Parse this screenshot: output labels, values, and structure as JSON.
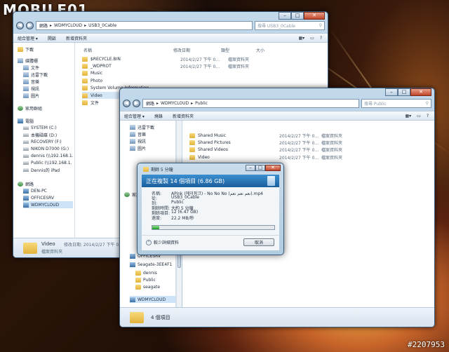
{
  "watermark": {
    "logo": "MOBILE01",
    "id": "#2207953"
  },
  "back_window": {
    "breadcrumb": [
      "網路",
      "WDMYCLOUD",
      "USB3_0Cable"
    ],
    "search_placeholder": "搜尋 USB3_0Cable",
    "toolbar": [
      "組合管理 ▾",
      "開啟",
      "新增資料夾"
    ],
    "nav_items": [
      {
        "label": "下載",
        "icon": "folder-icon"
      },
      {
        "label": "媒體櫃",
        "icon": "library-icon"
      },
      {
        "label": "文件",
        "icon": "library-icon"
      },
      {
        "label": "迅雷下載",
        "icon": "library-icon"
      },
      {
        "label": "音樂",
        "icon": "library-icon"
      },
      {
        "label": "視訊",
        "icon": "library-icon"
      },
      {
        "label": "圖片",
        "icon": "library-icon"
      },
      {
        "label": "家用群組",
        "icon": "homegroup-icon"
      },
      {
        "label": "電腦",
        "icon": "computer-icon"
      },
      {
        "label": "SYSTEM (C:)",
        "icon": "drive-icon"
      },
      {
        "label": "本機磁碟 (D:)",
        "icon": "drive-icon"
      },
      {
        "label": "RECOVERY (F:)",
        "icon": "drive-icon"
      },
      {
        "label": "NIKON D7000 (G:)",
        "icon": "drive-icon"
      },
      {
        "label": "dennis (\\\\192.168.1.",
        "icon": "drive-icon"
      },
      {
        "label": "Public (\\\\192.168.1.",
        "icon": "drive-icon"
      },
      {
        "label": "Dennis的 iPad",
        "icon": "drive-icon"
      },
      {
        "label": "網路",
        "icon": "network-icon"
      },
      {
        "label": "DEN-PC",
        "icon": "computer-icon"
      },
      {
        "label": "OFFICESRV",
        "icon": "computer-icon"
      },
      {
        "label": "WDMYCLOUD",
        "icon": "computer-icon"
      }
    ],
    "columns": [
      "名稱",
      "修改日期",
      "類型",
      "大小"
    ],
    "files": [
      {
        "name": "$RECYCLE.BIN",
        "date": "2014/2/27 下午 0...",
        "type": "檔案資料夾"
      },
      {
        "name": "_WDPROT",
        "date": "2014/2/27 下午 0...",
        "type": "檔案資料夾"
      },
      {
        "name": "Music",
        "date": "",
        "type": ""
      },
      {
        "name": "Photo",
        "date": "",
        "type": ""
      },
      {
        "name": "System Volume Information",
        "date": "",
        "type": ""
      },
      {
        "name": "Video",
        "date": "",
        "type": ""
      },
      {
        "name": "文件",
        "date": "",
        "type": ""
      }
    ],
    "status": {
      "name": "Video",
      "detail": "修改日期: 2014/2/27 下午 05...",
      "type": "檔案資料夾"
    }
  },
  "front_window": {
    "breadcrumb": [
      "網路",
      "WDMYCLOUD",
      "Public"
    ],
    "search_placeholder": "搜尋 Public",
    "toolbar": [
      "組合管理 ▾",
      "燒錄",
      "新增資料夾"
    ],
    "nav_items": [
      {
        "label": "迅雷下載",
        "icon": "library-icon"
      },
      {
        "label": "音樂",
        "icon": "library-icon"
      },
      {
        "label": "視訊",
        "icon": "library-icon"
      },
      {
        "label": "圖片",
        "icon": "library-icon"
      },
      {
        "label": "家用群組",
        "icon": "homegroup-icon"
      },
      {
        "label": "OFFICESRV",
        "icon": "computer-icon"
      },
      {
        "label": "Seagate-3EE4F1",
        "icon": "computer-icon"
      },
      {
        "label": "dennis",
        "icon": "folder-icon"
      },
      {
        "label": "Public",
        "icon": "folder-icon"
      },
      {
        "label": "seagate",
        "icon": "folder-icon"
      },
      {
        "label": "WDMYCLOUD",
        "icon": "computer-icon"
      }
    ],
    "files": [
      {
        "name": "Shared Music",
        "date": "2014/2/27 下午 0...",
        "type": "檔案資料夾"
      },
      {
        "name": "Shared Pictures",
        "date": "2014/2/27 下午 0...",
        "type": "檔案資料夾"
      },
      {
        "name": "Shared Videos",
        "date": "2014/2/27 下午 0...",
        "type": "檔案資料夾"
      },
      {
        "name": "Video",
        "date": "2014/2/27 下午 0...",
        "type": "檔案資料夾"
      }
    ],
    "status": {
      "count": "4 個項目"
    }
  },
  "copy_dialog": {
    "title": "剩餘 5 分鐘",
    "heading": "正在複製 14 個項目 (6.86 GB)",
    "name_label": "名稱:",
    "name_value": "APink (에이핑크) - No No No (نعم نعم نعم).mp4",
    "from_label": "從:",
    "from_value": "USB3_0Cable",
    "to_label": "到:",
    "to_value": "Public",
    "time_label": "剩餘時間:",
    "time_value": "大約 5 分鐘",
    "items_label": "剩餘項目:",
    "items_value": "12 (6.47 GB)",
    "speed_label": "速度:",
    "speed_value": "22.2 MB/秒",
    "progress": 0.06,
    "less_label": "較少詳細資料",
    "cancel_label": "取消"
  }
}
